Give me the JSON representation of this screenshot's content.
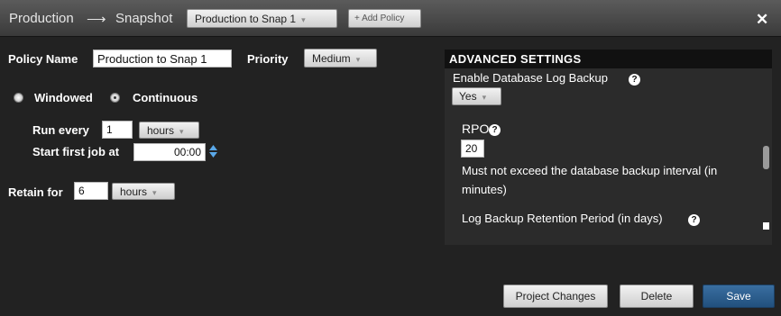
{
  "titlebar": {
    "source": "Production",
    "arrow": "⟶",
    "target": "Snapshot",
    "policy_select": "Production to Snap 1",
    "add_policy": "+ Add Policy",
    "close": "✕"
  },
  "form": {
    "policy_name_label": "Policy Name",
    "policy_name_value": "Production to Snap 1",
    "priority_label": "Priority",
    "priority_value": "Medium",
    "mode_windowed": "Windowed",
    "mode_continuous": "Continuous",
    "mode_selected": "Continuous",
    "run_every_label": "Run every",
    "run_every_value": "1",
    "run_every_unit": "hours",
    "start_first_label": "Start first job at",
    "start_first_value": "00:00",
    "retain_label": "Retain for",
    "retain_value": "6",
    "retain_unit": "hours"
  },
  "advanced": {
    "header": "ADVANCED SETTINGS",
    "db_log_label": "Enable Database Log Backup",
    "db_log_value": "Yes",
    "rpo_label": "RPO",
    "rpo_value": "20",
    "rpo_hint_1": "Must not exceed the database backup interval (in",
    "rpo_hint_2": "minutes)",
    "retention_label": "Log Backup Retention Period (in days)"
  },
  "footer": {
    "project_changes": "Project Changes",
    "delete": "Delete",
    "save": "Save"
  },
  "icons": {
    "help": "?",
    "caret": "▾"
  }
}
